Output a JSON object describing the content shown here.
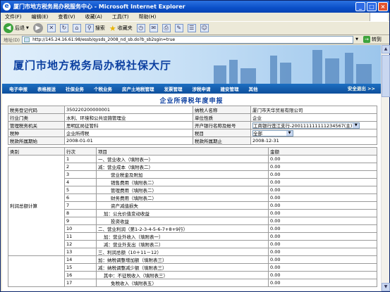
{
  "window": {
    "title": "厦门市地方税务局办税服务中心 - Microsoft Internet Explorer",
    "controls": [
      "_",
      "□",
      "×"
    ]
  },
  "menu": [
    "文件(F)",
    "编辑(E)",
    "查看(V)",
    "收藏(A)",
    "工具(T)",
    "帮助(H)"
  ],
  "toolbar": {
    "back": "后退",
    "search": "搜索",
    "favorites": "收藏夹"
  },
  "address": {
    "label": "地址(D)",
    "url": "http://145.24.16.61:98/essb/qysds_2008_nd_sb.do?b_sb2sgin=true",
    "go": "转到"
  },
  "banner": {
    "title": "厦门市地方税务局办税社保大厅"
  },
  "nav": {
    "items": [
      "电子申报",
      "表格报送",
      "社保业务",
      "个税业务",
      "房产土地税管理",
      "发票管理",
      "涉税申请",
      "建安管理",
      "其他"
    ],
    "exit": "安全退出 >>"
  },
  "form": {
    "title": "企业所得税年度申报",
    "header": [
      [
        "税务登记代码",
        "350220200000001",
        "纳税人名称",
        "厦门市天华贸易有限公司"
      ],
      [
        "行业门类",
        "水利、环境和公共设施管理业",
        "单位性质",
        "企业"
      ],
      [
        "管理税务机关",
        "思明区局征管科",
        "开户银行名称及帐号",
        "工商银行莲江支行-200111111111234567(主)"
      ],
      [
        "税种",
        "企业所得税",
        "税目",
        "全部"
      ],
      [
        "税款所属期始",
        "2008-01-01",
        "税款所属期止",
        "2008-12-31"
      ]
    ],
    "columns": [
      "类别",
      "行次",
      "项目",
      "金额"
    ],
    "category_label": "利润总额计算",
    "rows": [
      {
        "no": "1",
        "item": "一、营业收入（填附表一）",
        "amount": "0.00",
        "indent": 0
      },
      {
        "no": "2",
        "item": "减：营业成本（填附表二）",
        "amount": "0.00",
        "indent": 0
      },
      {
        "no": "3",
        "item": "营业税金及附加",
        "amount": "0.00",
        "indent": 2
      },
      {
        "no": "4",
        "item": "销售费用（填附表二）",
        "amount": "0.00",
        "indent": 2
      },
      {
        "no": "5",
        "item": "管理费用（填附表二）",
        "amount": "0.00",
        "indent": 2
      },
      {
        "no": "6",
        "item": "财务费用（填附表二）",
        "amount": "0.00",
        "indent": 2
      },
      {
        "no": "7",
        "item": "资产减值损失",
        "amount": "0.00",
        "indent": 2
      },
      {
        "no": "8",
        "item": "加：公允价值变动收益",
        "amount": "0.00",
        "indent": 1
      },
      {
        "no": "9",
        "item": "投资收益",
        "amount": "0.00",
        "indent": 2
      },
      {
        "no": "10",
        "item": "二、营业利润（第1-2-3-4-5-6-7+8+9行）",
        "amount": "0.00",
        "indent": 0
      },
      {
        "no": "11",
        "item": "加：营业外收入（填附表一）",
        "amount": "0.00",
        "indent": 1
      },
      {
        "no": "12",
        "item": "减：营业外支出（填附表二）",
        "amount": "0.00",
        "indent": 1
      },
      {
        "no": "13",
        "item": "三、利润总额（10＋11－12）",
        "amount": "0.00",
        "indent": 0
      },
      {
        "no": "14",
        "item": "加：纳税调整增加额（填附表三）",
        "amount": "0.00",
        "indent": 0
      },
      {
        "no": "15",
        "item": "减：纳税调整减少额（填附表三）",
        "amount": "0.00",
        "indent": 0
      },
      {
        "no": "16",
        "item": "其中：不征税收入（填附表三）",
        "amount": "0.00",
        "indent": 1
      },
      {
        "no": "17",
        "item": "免税收入（填附表五）",
        "amount": "0.00",
        "indent": 2
      }
    ]
  }
}
